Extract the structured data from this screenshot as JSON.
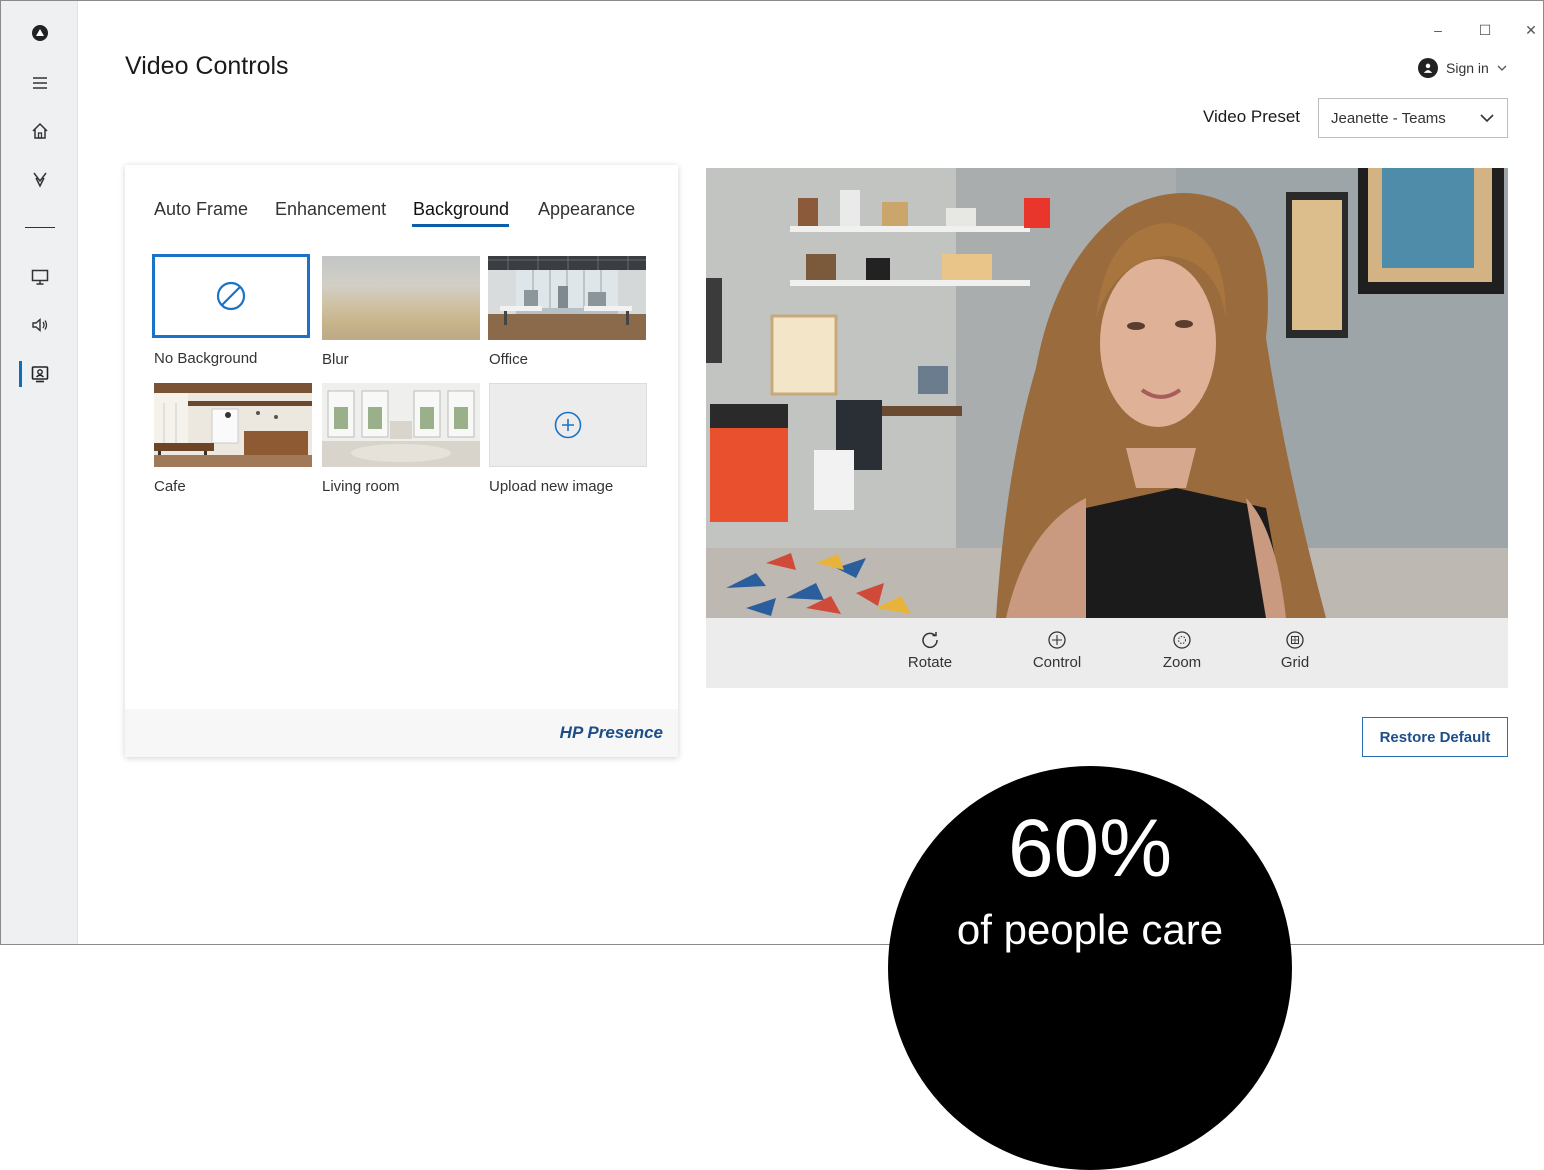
{
  "window": {
    "minimize": "–",
    "maximize": "☐",
    "close": "✕"
  },
  "page": {
    "title": "Video Controls"
  },
  "account": {
    "signin_label": "Sign in"
  },
  "preset": {
    "label": "Video Preset",
    "selected": "Jeanette - Teams"
  },
  "tabs": [
    {
      "label": "Auto Frame"
    },
    {
      "label": "Enhancement"
    },
    {
      "label": "Background",
      "active": true
    },
    {
      "label": "Appearance"
    }
  ],
  "backgrounds": [
    {
      "label": "No Background",
      "selected": true
    },
    {
      "label": "Blur"
    },
    {
      "label": "Office"
    },
    {
      "label": "Cafe"
    },
    {
      "label": "Living room"
    },
    {
      "label": "Upload new image"
    }
  ],
  "brand": "HP Presence",
  "controls": [
    {
      "label": "Rotate",
      "icon": "rotate-icon"
    },
    {
      "label": "Control",
      "icon": "control-icon"
    },
    {
      "label": "Zoom",
      "icon": "zoom-icon"
    },
    {
      "label": "Grid",
      "icon": "grid-icon"
    }
  ],
  "restore_label": "Restore Default",
  "stat": {
    "value": "60%",
    "caption": "of people care"
  },
  "colors": {
    "accent": "#0d6fb8",
    "brand": "#1d4e89",
    "sidebar": "#eef0f2"
  },
  "sidebar_icons": [
    "app-logo-icon",
    "menu-icon",
    "home-icon",
    "ribbon-icon",
    "display-icon",
    "speaker-icon",
    "camera-icon"
  ]
}
